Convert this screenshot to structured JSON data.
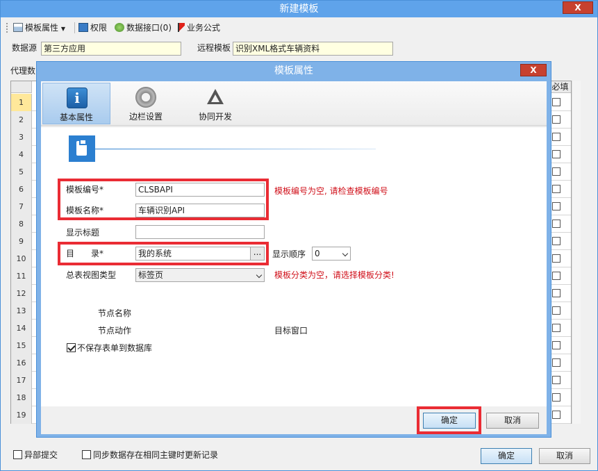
{
  "outer": {
    "title": "新建模板",
    "close_label": "X",
    "toolbar": {
      "template_props": "模板属性",
      "permissions": "权限",
      "data_interface": "数据接口(0)",
      "business_formula": "业务公式"
    },
    "datasource_label": "数据源",
    "datasource_value": "第三方应用",
    "remote_template_label": "远程模板",
    "remote_template_value": "识别XML格式车辆资料",
    "proxy_label": "代理数",
    "grid": {
      "col_required": "必填",
      "rows": [
        "1",
        "2",
        "3",
        "4",
        "5",
        "6",
        "7",
        "8",
        "9",
        "10",
        "11",
        "12",
        "13",
        "14",
        "15",
        "16",
        "17",
        "18",
        "19"
      ]
    },
    "async_submit": "异部提交",
    "sync_update": "同步数据存在相同主键时更新记录",
    "confirm": "确定",
    "cancel": "取消"
  },
  "dialog": {
    "title": "模板属性",
    "close_label": "X",
    "tabs": [
      {
        "label": "基本属性",
        "icon": "info-icon"
      },
      {
        "label": "边栏设置",
        "icon": "gear-icon"
      },
      {
        "label": "协同开发",
        "icon": "recycle-icon"
      }
    ],
    "form": {
      "code_label": "模板编号*",
      "code_value": "CLSBAPI",
      "code_error": "模板编号为空, 请检查模板编号",
      "name_label": "模板名称*",
      "name_value": "车辆识别API",
      "display_title_label": "显示标题",
      "display_title_value": "",
      "dir_label": "目　　录*",
      "dir_value": "我的系统",
      "dir_browse": "...",
      "order_label": "显示顺序",
      "order_value": "0",
      "view_type_label": "总表视图类型",
      "view_type_value": "标签页",
      "view_type_error": "模板分类为空，请选择模板分类!",
      "node_name_label": "节点名称",
      "node_action_label": "节点动作",
      "target_window_label": "目标窗口",
      "no_save_label": "不保存表单到数据库"
    },
    "confirm": "确定",
    "cancel": "取消"
  }
}
